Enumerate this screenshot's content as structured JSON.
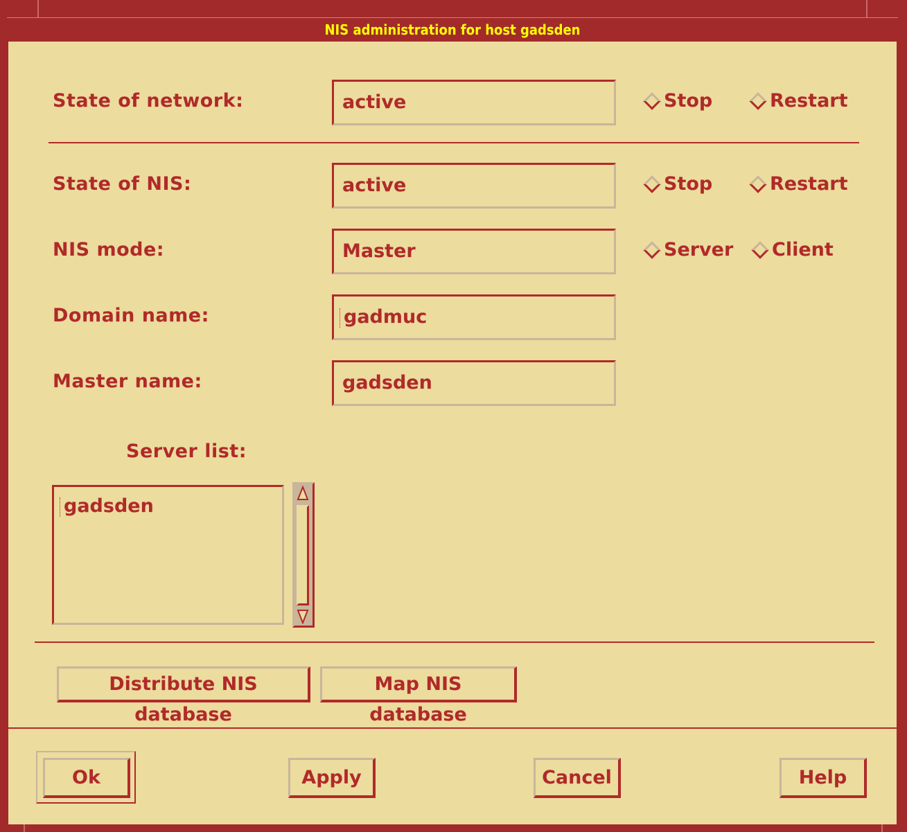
{
  "window": {
    "title": "NIS administration for host gadsden"
  },
  "network": {
    "label": "State of network:",
    "value": "active",
    "stop_label": "Stop",
    "restart_label": "Restart"
  },
  "nis_state": {
    "label": "State of NIS:",
    "value": "active",
    "stop_label": "Stop",
    "restart_label": "Restart"
  },
  "nis_mode": {
    "label": "NIS mode:",
    "value": "Master",
    "server_label": "Server",
    "client_label": "Client"
  },
  "domain": {
    "label": "Domain name:",
    "value": "gadmuc"
  },
  "master": {
    "label": "Master name:",
    "value": "gadsden"
  },
  "server_list": {
    "label": "Server list:",
    "items": [
      "gadsden"
    ]
  },
  "actions": {
    "distribute_label": "Distribute NIS database",
    "map_label": "Map NIS database"
  },
  "footer": {
    "ok_label": "Ok",
    "apply_label": "Apply",
    "cancel_label": "Cancel",
    "help_label": "Help"
  },
  "colors": {
    "background": "#ecdc9e",
    "frame": "#a32a2a",
    "text": "#b02a2a",
    "title_text": "#ffff00",
    "shadow": "#c9b59a"
  }
}
